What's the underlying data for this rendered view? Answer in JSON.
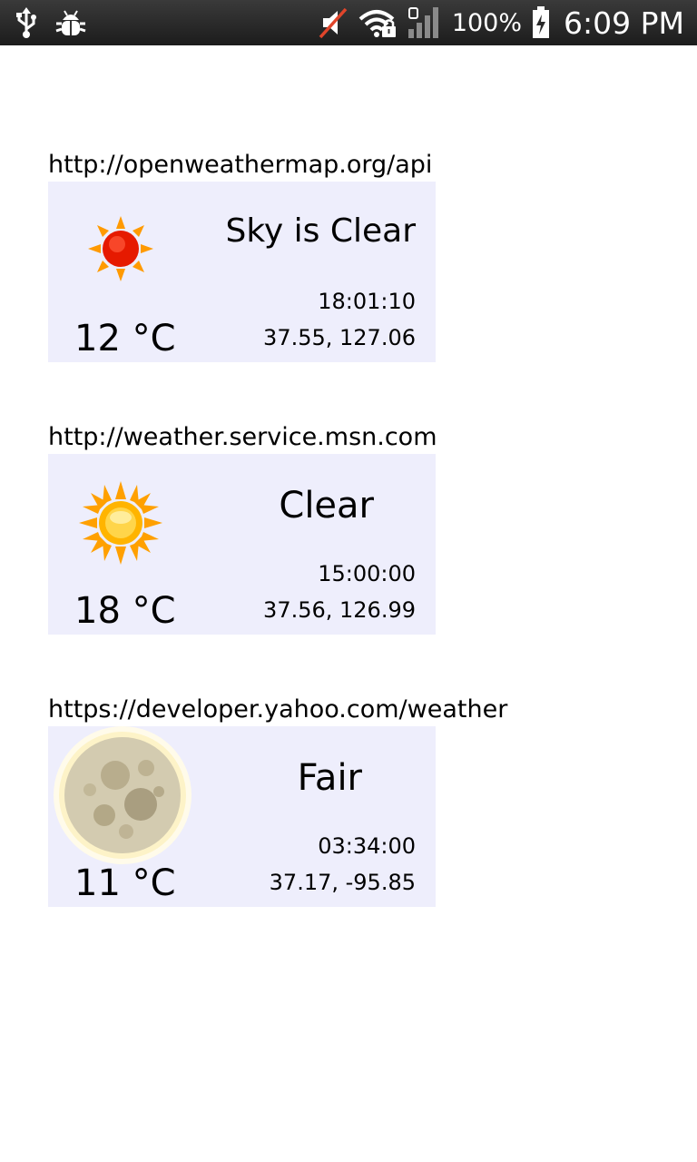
{
  "status_bar": {
    "battery_percent": "100%",
    "time": "6:09 PM",
    "icons": [
      "usb-icon",
      "debug-bug-icon",
      "mute-icon",
      "wifi-lock-icon",
      "signal-icon",
      "battery-charging-icon"
    ]
  },
  "cards": [
    {
      "source_url": "http://openweathermap.org/api",
      "condition": "Sky is Clear",
      "time": "18:01:10",
      "coords": "37.55, 127.06",
      "temp": "12 °C",
      "icon": "red-sun-icon"
    },
    {
      "source_url": "http://weather.service.msn.com",
      "condition": "Clear",
      "time": "15:00:00",
      "coords": "37.56, 126.99",
      "temp": "18 °C",
      "icon": "sun-icon"
    },
    {
      "source_url": "https://developer.yahoo.com/weather",
      "condition": "Fair",
      "time": "03:34:00",
      "coords": "37.17, -95.85",
      "temp": "11 °C",
      "icon": "moon-icon"
    }
  ],
  "colors": {
    "card_background": "#eeeefc",
    "status_bar": "#2a2a2a"
  }
}
